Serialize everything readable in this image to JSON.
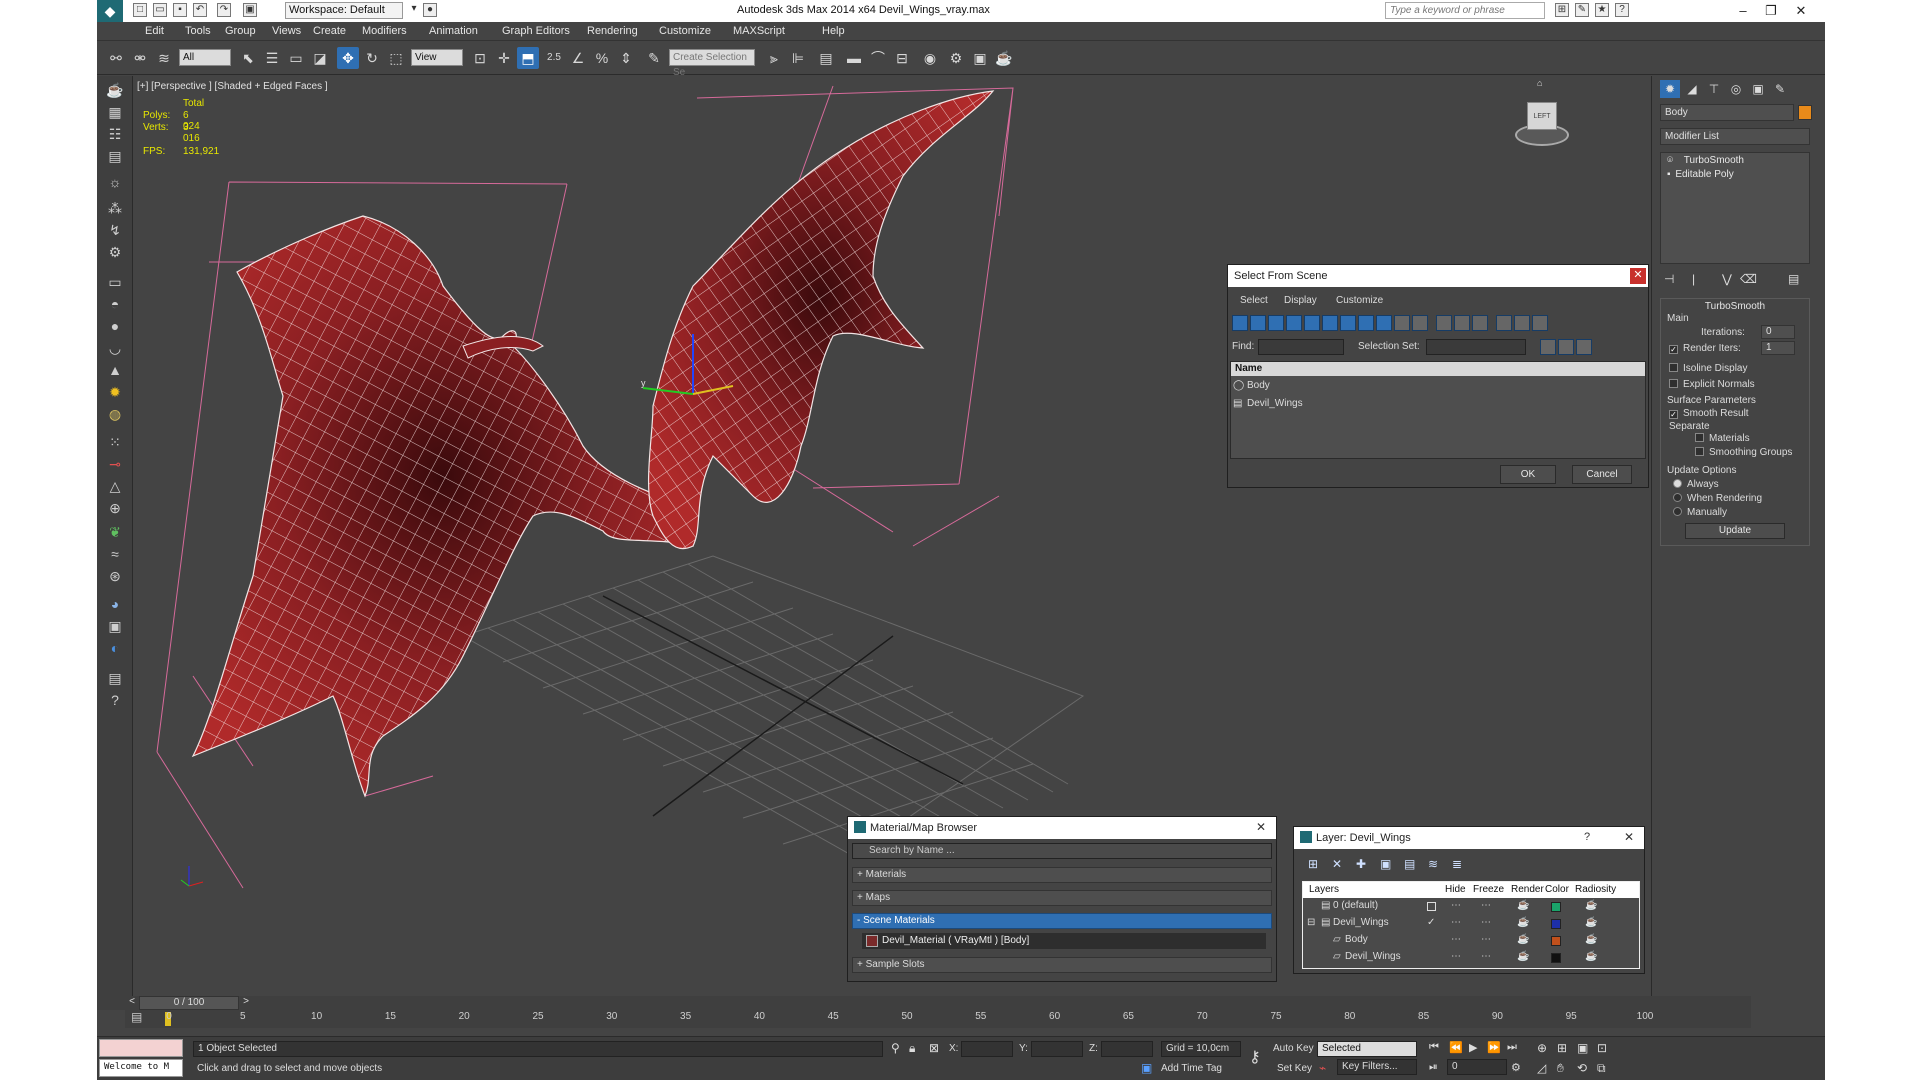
{
  "titlebar": {
    "workspace": "Workspace: Default",
    "title": "Autodesk 3ds Max  2014 x64     Devil_Wings_vray.max",
    "search_placeholder": "Type a keyword or phrase"
  },
  "menu": [
    "Edit",
    "Tools",
    "Group",
    "Views",
    "Create",
    "Modifiers",
    "Animation",
    "Graph Editors",
    "Rendering",
    "Customize",
    "MAXScript",
    "Help"
  ],
  "toolbar": {
    "filter_value": "All",
    "refcoord_value": "View",
    "angle_snap": "2.5",
    "selection_set_placeholder": "Create Selection Se"
  },
  "viewport": {
    "label": "[+] [Perspective ] [Shaded + Edged Faces ]",
    "stats": {
      "total_label": "Total",
      "polys_label": "Polys:",
      "polys_value": "6 024",
      "verts_label": "Verts:",
      "verts_value": "3 016",
      "fps_label": "FPS:",
      "fps_value": "131,921"
    },
    "viewcube_label": "LEFT"
  },
  "command_panel": {
    "object_name": "Body",
    "modifier_list": "Modifier List",
    "stack": [
      "TurboSmooth",
      "Editable Poly"
    ],
    "rollout_title": "TurboSmooth",
    "main_label": "Main",
    "iterations_label": "Iterations:",
    "iterations_value": "0",
    "render_iters_label": "Render Iters:",
    "render_iters_value": "1",
    "isoline_label": "Isoline Display",
    "explicit_normals_label": "Explicit Normals",
    "surface_params_label": "Surface Parameters",
    "smooth_result_label": "Smooth Result",
    "separate_label": "Separate",
    "materials_label": "Materials",
    "smoothing_groups_label": "Smoothing Groups",
    "update_options_label": "Update Options",
    "always_label": "Always",
    "when_rendering_label": "When Rendering",
    "manually_label": "Manually",
    "update_button": "Update"
  },
  "select_from_scene": {
    "title": "Select From Scene",
    "menu": [
      "Select",
      "Display",
      "Customize"
    ],
    "find_label": "Find:",
    "selection_set_label": "Selection Set:",
    "column_name": "Name",
    "rows": [
      "Body",
      "Devil_Wings"
    ],
    "ok": "OK",
    "cancel": "Cancel"
  },
  "material_browser": {
    "title": "Material/Map Browser",
    "search_placeholder": "Search by Name ...",
    "sections": [
      "+ Materials",
      "+ Maps",
      "- Scene Materials",
      "+ Sample Slots"
    ],
    "scene_material": "Devil_Material  ( VRayMtl )  [Body]"
  },
  "layer_dialog": {
    "title": "Layer: Devil_Wings",
    "help": "?",
    "columns": [
      "Layers",
      "Hide",
      "Freeze",
      "Render",
      "Color",
      "Radiosity"
    ],
    "rows": [
      {
        "name": "0 (default)",
        "color": "#1aa36a"
      },
      {
        "name": "Devil_Wings",
        "color": "#1d2fa8"
      },
      {
        "name": "Body",
        "color": "#c0501c"
      },
      {
        "name": "Devil_Wings",
        "color": "#111111"
      }
    ]
  },
  "timeline": {
    "slider_label": "0 / 100",
    "ticks": [
      "0",
      "5",
      "10",
      "15",
      "20",
      "25",
      "30",
      "35",
      "40",
      "45",
      "50",
      "55",
      "60",
      "65",
      "70",
      "75",
      "80",
      "85",
      "90",
      "95",
      "100"
    ]
  },
  "statusbar": {
    "listener": "Welcome to M",
    "selected_text": "1 Object Selected",
    "prompt_text": "Click and drag to select and move objects",
    "x_label": "X:",
    "y_label": "Y:",
    "z_label": "Z:",
    "grid_text": "Grid = 10,0cm",
    "add_time_tag": "Add Time Tag",
    "auto_key": "Auto Key",
    "set_key": "Set Key",
    "selected_dropdown": "Selected",
    "key_filters": "Key Filters...",
    "frame_value": "0"
  },
  "colors": {
    "accent": "#2f6fb3",
    "wing_fill": "#8a1f22",
    "bbox_pink": "#d66a9a"
  }
}
